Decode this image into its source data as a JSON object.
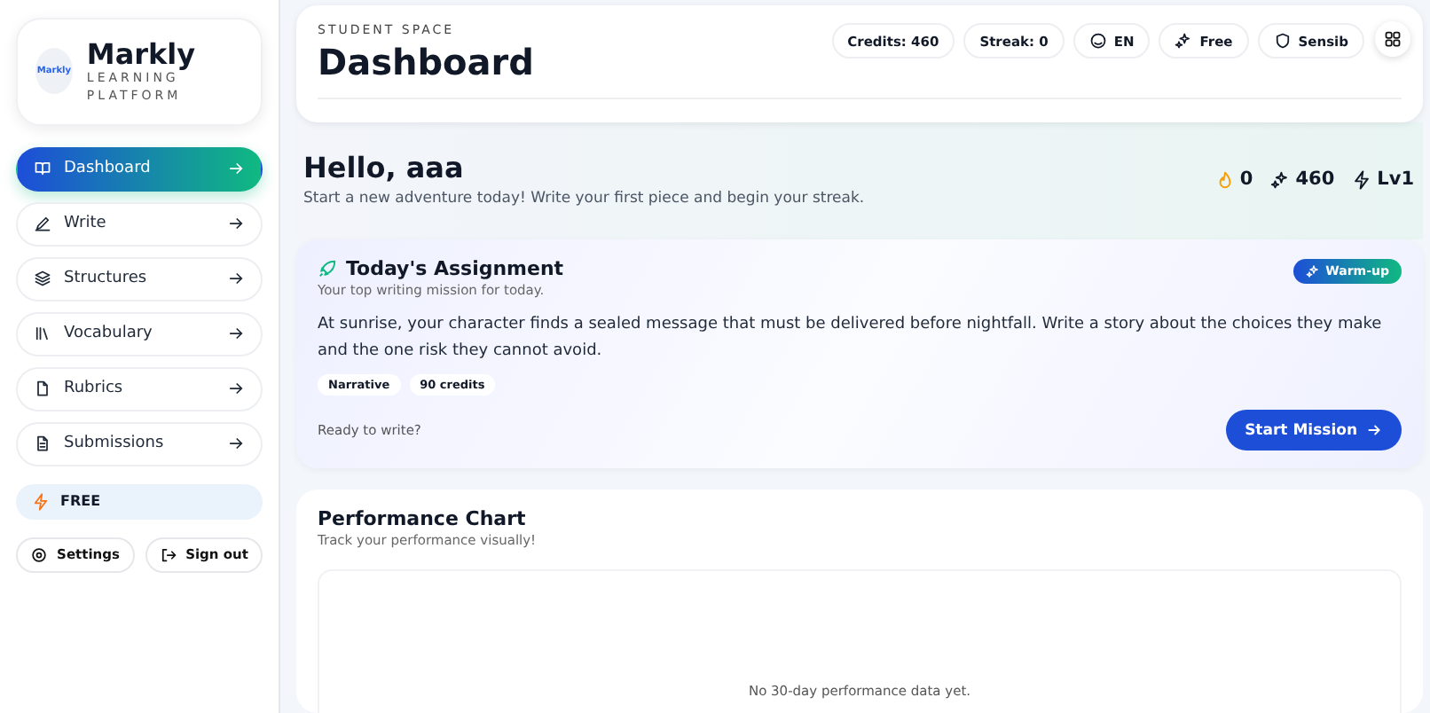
{
  "brand": {
    "logo_text": "Markly",
    "name": "Markly",
    "subtitle": "LEARNING PLATFORM"
  },
  "nav": [
    {
      "label": "Dashboard",
      "selected": true
    },
    {
      "label": "Write",
      "selected": false
    },
    {
      "label": "Structures",
      "selected": false
    },
    {
      "label": "Vocabulary",
      "selected": false
    },
    {
      "label": "Rubrics",
      "selected": false
    },
    {
      "label": "Submissions",
      "selected": false
    }
  ],
  "plan": "FREE",
  "footer_buttons": [
    "Settings",
    "Sign out"
  ],
  "header": {
    "eyebrow": "STUDENT SPACE",
    "title": "Dashboard",
    "chips": [
      "Credits: 460",
      "Streak: 0",
      "EN",
      "Free",
      "Sensib"
    ]
  },
  "greeting": {
    "title": "Hello, aaa",
    "subtitle": "Start a new adventure today! Write your first piece and begin your streak.",
    "stats": [
      "0",
      "460",
      "Lv1"
    ]
  },
  "assignment": {
    "title": "Today's Assignment",
    "subtitle": "Your top writing mission for today.",
    "badge": "Warm-up",
    "prompt": "At sunrise, your character finds a sealed message that must be delivered before nightfall. Write a story about the choices they make and the one risk they cannot avoid.",
    "tags": [
      "Narrative",
      "90 credits"
    ],
    "footer": "Ready to write?",
    "button": "Start Mission"
  },
  "performance": {
    "title": "Performance Chart",
    "subtitle": "Track your performance visually!",
    "empty": "No 30-day performance data yet."
  }
}
